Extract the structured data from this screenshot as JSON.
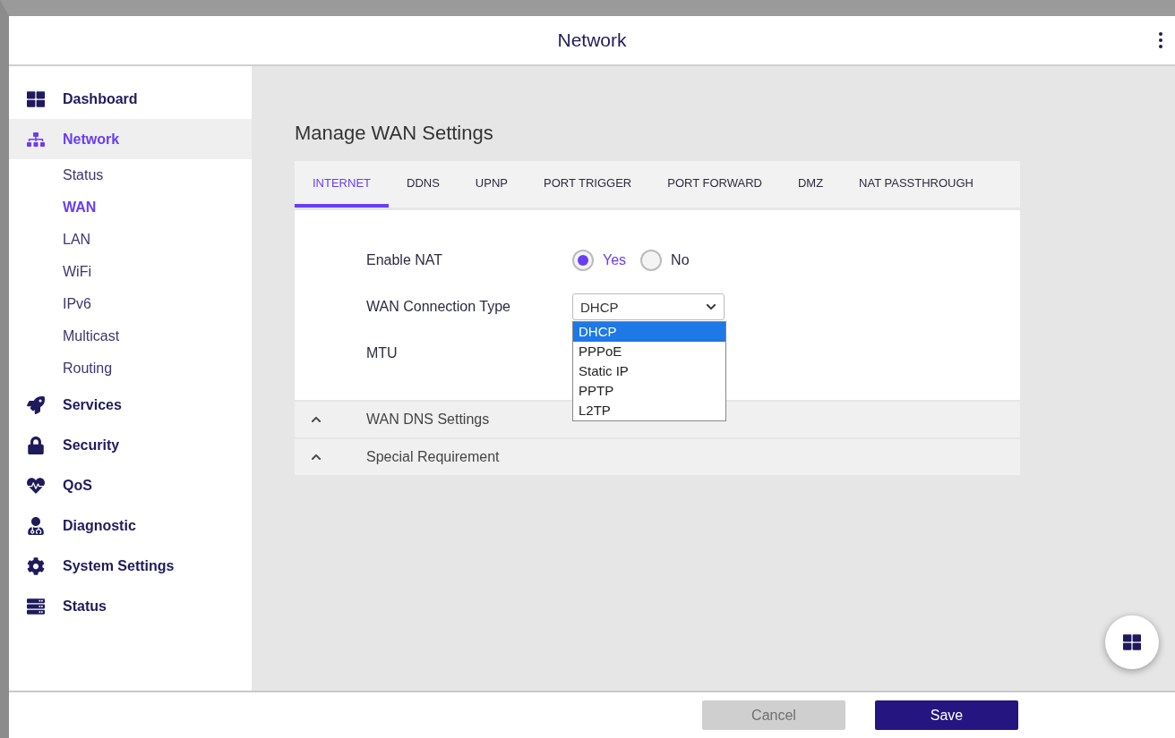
{
  "header": {
    "title": "Network"
  },
  "sidebar": {
    "items": [
      {
        "label": "Dashboard",
        "selected": false
      },
      {
        "label": "Network",
        "selected": true,
        "children": [
          {
            "label": "Status",
            "selected": false
          },
          {
            "label": "WAN",
            "selected": true
          },
          {
            "label": "LAN",
            "selected": false
          },
          {
            "label": "WiFi",
            "selected": false
          },
          {
            "label": "IPv6",
            "selected": false
          },
          {
            "label": "Multicast",
            "selected": false
          },
          {
            "label": "Routing",
            "selected": false
          }
        ]
      },
      {
        "label": "Services",
        "selected": false
      },
      {
        "label": "Security",
        "selected": false
      },
      {
        "label": "QoS",
        "selected": false
      },
      {
        "label": "Diagnostic",
        "selected": false
      },
      {
        "label": "System Settings",
        "selected": false
      },
      {
        "label": "Status",
        "selected": false
      }
    ]
  },
  "page_title": "Manage WAN Settings",
  "tabs": [
    {
      "label": "INTERNET",
      "selected": true
    },
    {
      "label": "DDNS",
      "selected": false
    },
    {
      "label": "UPNP",
      "selected": false
    },
    {
      "label": "PORT TRIGGER",
      "selected": false
    },
    {
      "label": "PORT FORWARD",
      "selected": false
    },
    {
      "label": "DMZ",
      "selected": false
    },
    {
      "label": "NAT PASSTHROUGH",
      "selected": false
    }
  ],
  "enable_nat": {
    "label": "Enable NAT",
    "options": [
      {
        "label": "Yes",
        "selected": true
      },
      {
        "label": "No",
        "selected": false
      }
    ]
  },
  "connection_type": {
    "label": "WAN Connection Type",
    "value": "DHCP",
    "expanded": true,
    "options": [
      {
        "label": "DHCP",
        "selected": true
      },
      {
        "label": "PPPoE",
        "selected": false
      },
      {
        "label": "Static IP",
        "selected": false
      },
      {
        "label": "PPTP",
        "selected": false
      },
      {
        "label": "L2TP",
        "selected": false
      }
    ]
  },
  "mtu": {
    "label": "MTU"
  },
  "accordions": [
    {
      "label": "WAN DNS Settings"
    },
    {
      "label": "Special Requirement"
    }
  ],
  "buttons": [
    {
      "label": "Cancel",
      "disabled": true
    },
    {
      "label": "Save",
      "disabled": false
    }
  ]
}
